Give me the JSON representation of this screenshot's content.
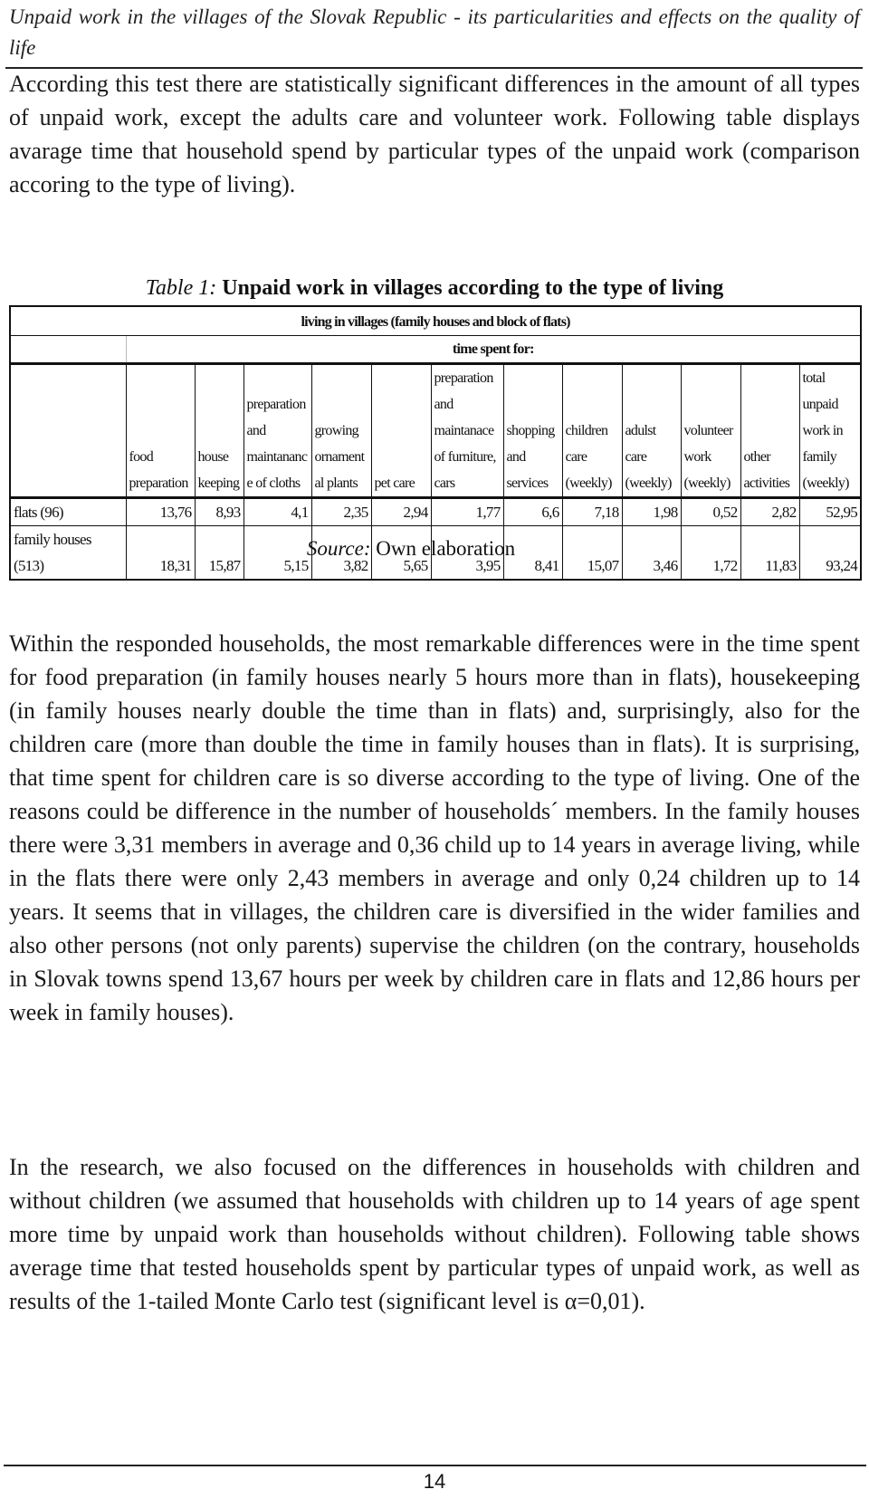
{
  "running_head": "Unpaid work in the villages of the Slovak Republic - its particularities and effects on the quality of life",
  "paragraphs": {
    "intro": "According this test there are statistically significant differences in the amount of all types of unpaid work, except the adults care and volunteer work. Following table displays avarage time that household spend by particular types of the unpaid work (comparison accoring to the type of living).",
    "discussion": "Within the responded households, the most remarkable differences were in the time spent for food preparation (in family houses nearly 5 hours more than in flats), housekeeping (in family houses nearly double the time than in flats) and, surprisingly, also for the children care (more than double the time in family houses than in flats). It is surprising, that time spent for children care is so diverse according to the type of living. One of the reasons could be difference in the number of households´ members. In the family houses there were 3,31 members in average and 0,36 child up to 14 years in average living, while in the flats there were only 2,43 members in average and only 0,24 children up to 14 years. It seems that in villages, the children care is diversified in the wider families and also other persons (not only parents) supervise the children (on the contrary, households in Slovak towns spend 13,67 hours per week by children care in flats and 12,86 hours per week in family houses).",
    "research": "In the research, we also focused on the differences in households with children and without children (we assumed that households with children up to 14 years of age spent more time by unpaid work than households without children). Following table shows average time that tested households spent by particular types of unpaid work, as well as results of the 1-tailed Monte Carlo test (significant level is α=0,01)."
  },
  "table": {
    "caption_label": "Table 1:",
    "caption_title": "Unpaid work in villages according to the type of living",
    "group_header": "living in villages (family houses and block of flats)",
    "sub_header": "time spent for:",
    "columns": [
      "food\npreparation",
      "house\nkeeping",
      "preparation\nand\nmaintananc\ne of cloths",
      "growing\nornament\nal plants",
      "pet care",
      "preparation\nand\nmaintanace\nof furniture,\ncars",
      "shopping\nand\nservices",
      "children\ncare\n(weekly)",
      "adulst\ncare\n(weekly)",
      "volunteer\nwork\n(weekly)",
      "other\nactivities",
      "total\nunpaid\nwork in\nfamily\n(weekly)"
    ],
    "rows": [
      {
        "label": "flats (96)",
        "values": [
          "13,76",
          "8,93",
          "4,1",
          "2,35",
          "2,94",
          "1,77",
          "6,6",
          "7,18",
          "1,98",
          "0,52",
          "2,82",
          "52,95"
        ]
      },
      {
        "label": "family houses (513)",
        "values": [
          "18,31",
          "15,87",
          "5,15",
          "3,82",
          "5,65",
          "3,95",
          "8,41",
          "15,07",
          "3,46",
          "1,72",
          "11,83",
          "93,24"
        ]
      }
    ],
    "source_label": "Source:",
    "source_text": " Own elaboration"
  },
  "page_number": "14"
}
